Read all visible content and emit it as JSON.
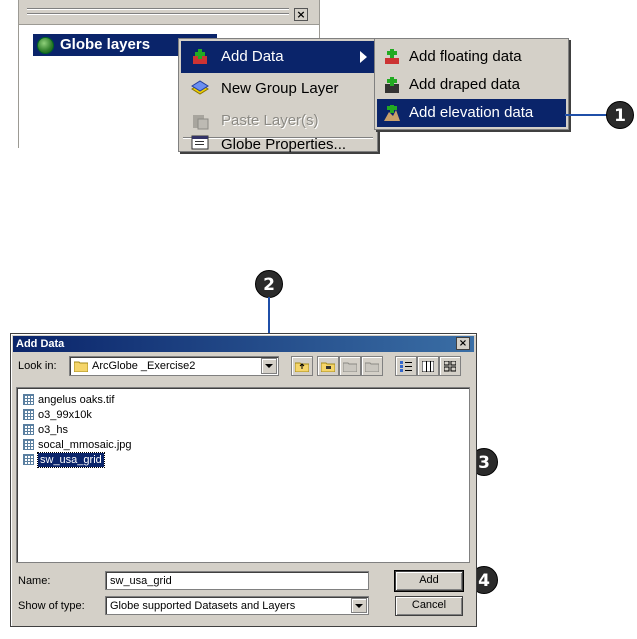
{
  "toc": {
    "root_label": "Globe layers",
    "close_glyph": "×"
  },
  "context_menu": {
    "items": [
      {
        "label": "Add Data",
        "icon": "add-data-icon",
        "state": "highlighted",
        "has_submenu": true
      },
      {
        "label": "New Group Layer",
        "icon": "group-layer-icon",
        "state": "normal"
      },
      {
        "label": "Paste Layer(s)",
        "icon": "paste-icon",
        "state": "disabled"
      },
      {
        "label": "Globe Properties...",
        "icon": "properties-icon",
        "state": "normal"
      }
    ]
  },
  "submenu": {
    "items": [
      {
        "label": "Add floating data",
        "icon": "floating-data-icon"
      },
      {
        "label": "Add draped data",
        "icon": "draped-data-icon"
      },
      {
        "label": "Add elevation data",
        "icon": "elevation-data-icon",
        "state": "highlighted"
      }
    ]
  },
  "callouts": [
    "1",
    "2",
    "3",
    "4"
  ],
  "dialog": {
    "title": "Add Data",
    "close_glyph": "×",
    "look_in_label": "Look in:",
    "look_in_value": "ArcGlobe _Exercise2",
    "files": [
      {
        "name": "angelus oaks.tif"
      },
      {
        "name": "o3_99x10k"
      },
      {
        "name": "o3_hs"
      },
      {
        "name": "socal_mmosaic.jpg"
      },
      {
        "name": "sw_usa_grid",
        "selected": true
      }
    ],
    "name_label": "Name:",
    "name_value": "sw_usa_grid",
    "type_label": "Show of type:",
    "type_value": "Globe supported Datasets and Layers",
    "add_button": "Add",
    "cancel_button": "Cancel"
  },
  "colors": {
    "highlight": "#0a246a",
    "chrome": "#d4d0c8",
    "callout_line": "#1f4fa8"
  }
}
